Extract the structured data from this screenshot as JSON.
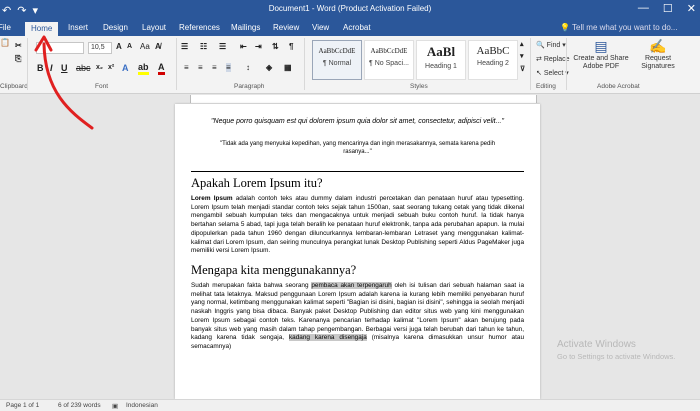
{
  "title_bar": {
    "doc_title": "Document1 - Word (Product Activation Failed)",
    "undo_icon": "↶",
    "redo_icon": "↷",
    "customize_icon": "▾",
    "minimize": "—",
    "maximize": "☐",
    "close": "✕"
  },
  "tabs": [
    "File",
    "Home",
    "Insert",
    "Design",
    "Layout",
    "References",
    "Mailings",
    "Review",
    "View",
    "Acrobat"
  ],
  "active_tab": "Home",
  "tell_me": "Tell me what you want to do...",
  "ribbon": {
    "clipboard_label": "Clipboard",
    "font_label": "Font",
    "paragraph_label": "Paragraph",
    "styles_label": "Styles",
    "editing_label": "Editing",
    "adobe_label": "Adobe Acrobat",
    "font_name": "",
    "font_size": "10,5",
    "styles": [
      {
        "sample": "AaBbCcDdE",
        "name": "¶ Normal"
      },
      {
        "sample": "AaBbCcDdE",
        "name": "¶ No Spaci..."
      },
      {
        "sample": "AaBl",
        "name": "Heading 1"
      },
      {
        "sample": "AaBbC",
        "name": "Heading 2"
      }
    ],
    "find": "Find",
    "replace": "Replace",
    "select": "Select",
    "create_share": "Create and Share Adobe PDF",
    "request_sig": "Request Signatures"
  },
  "document": {
    "quote1": "\"Neque porro quisquam est qui dolorem ipsum quia dolor sit amet, consectetur, adipisci velit...\"",
    "quote2": "\"Tidak ada yang menyukai kepedihan, yang mencarinya dan ingin merasakannya, semata karena pedih rasanya...\"",
    "heading1": "Apakah Lorem Ipsum itu?",
    "para1_bold": "Lorem Ipsum",
    "para1_rest": " adalah contoh teks atau dummy dalam industri percetakan dan penataan huruf atau typesetting. Lorem Ipsum telah menjadi standar contoh teks sejak tahun 1500an, saat seorang tukang cetak yang tidak dikenal mengambil sebuah kumpulan teks dan mengacaknya untuk menjadi sebuah buku contoh huruf. Ia tidak hanya bertahan selama 5 abad, tapi juga telah beralih ke penataan huruf elektronik, tanpa ada perubahan apapun. Ia mulai dipopulerkan pada tahun 1960 dengan diluncurkannya lembaran-lembaran Letraset yang menggunakan kalimat-kalimat dari Lorem Ipsum, dan seiring munculnya perangkat lunak Desktop Publishing seperti Aldus PageMaker juga memiliki versi Lorem Ipsum.",
    "heading2": "Mengapa kita menggunakannya?",
    "para2_a": "Sudah merupakan fakta bahwa seorang ",
    "para2_hl1": "pembaca akan terpengaruh",
    "para2_b": " oleh isi tulisan dari sebuah halaman saat ia melihat tata letaknya. Maksud penggunaan Lorem Ipsum adalah karena ia kurang lebih memiliki penyebaran huruf yang normal, ketimbang menggunakan kalimat seperti \"Bagian isi disini, bagian isi disini\", sehingga ia seolah menjadi naskah Inggris yang bisa dibaca. Banyak paket Desktop Publishing dan editor situs web yang kini menggunakan Lorem Ipsum sebagai contoh teks. Karenanya pencarian terhadap kalimat \"Lorem Ipsum\" akan berujung pada banyak situs web yang masih dalam tahap pengembangan. Berbagai versi juga telah berubah dari tahun ke tahun, kadang karena tidak sengaja, ",
    "para2_hl2": "kadang karena disengaja",
    "para2_c": " (misalnya karena dimasukkan unsur humor atau semacamnya)"
  },
  "status_bar": {
    "page": "Page 1 of 1",
    "words": "6 of 239 words",
    "language": "Indonesian"
  },
  "watermark": {
    "line1": "Activate Windows",
    "line2": "Go to Settings to activate Windows."
  },
  "colors": {
    "word_blue": "#2b579a",
    "arrow_red": "#e02020",
    "font_color_red": "#d00000",
    "highlight_yellow": "#ffff00"
  }
}
